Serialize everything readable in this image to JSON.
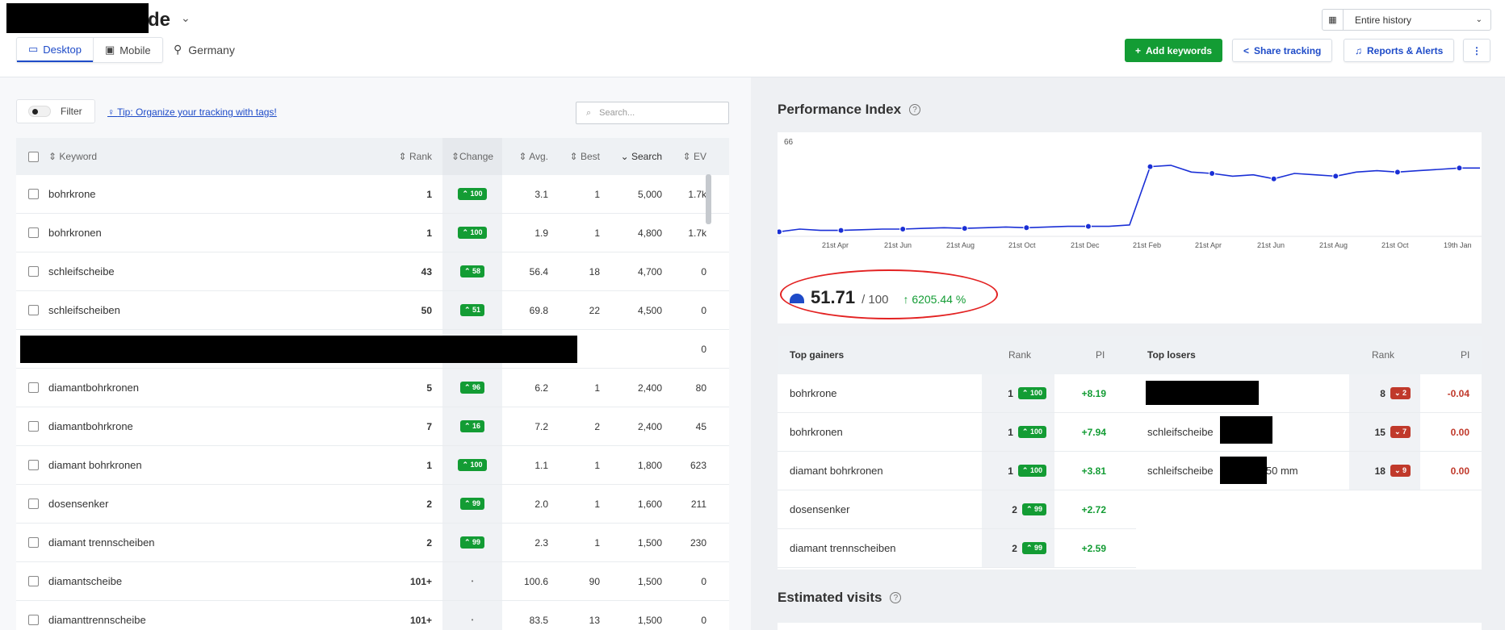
{
  "header": {
    "domain_suffix": "de",
    "devices": [
      "Desktop",
      "Mobile"
    ],
    "location": "Germany",
    "history": "Entire history",
    "buttons": {
      "add_keywords": "Add keywords",
      "share": "Share tracking",
      "reports": "Reports & Alerts"
    }
  },
  "left": {
    "filter_label": "Filter",
    "tip": "Tip: Organize your tracking with tags!",
    "search_placeholder": "Search...",
    "columns": [
      "Keyword",
      "Rank",
      "Change",
      "Avg.",
      "Best",
      "Search",
      "EV"
    ],
    "rows": [
      {
        "kw": "bohrkrone",
        "rank": "1",
        "change": "100",
        "avg": "3.1",
        "best": "1",
        "search": "5,000",
        "ev": "1.7k"
      },
      {
        "kw": "bohrkronen",
        "rank": "1",
        "change": "100",
        "avg": "1.9",
        "best": "1",
        "search": "4,800",
        "ev": "1.7k"
      },
      {
        "kw": "schleifscheibe",
        "rank": "43",
        "change": "58",
        "avg": "56.4",
        "best": "18",
        "search": "4,700",
        "ev": "0"
      },
      {
        "kw": "schleifscheiben",
        "rank": "50",
        "change": "51",
        "avg": "69.8",
        "best": "22",
        "search": "4,500",
        "ev": "0"
      },
      {
        "kw": "",
        "rank": "",
        "change": "",
        "avg": "",
        "best": "",
        "search": "",
        "ev": "0",
        "redacted": true
      },
      {
        "kw": "diamantbohrkronen",
        "rank": "5",
        "change": "96",
        "avg": "6.2",
        "best": "1",
        "search": "2,400",
        "ev": "80"
      },
      {
        "kw": "diamantbohrkrone",
        "rank": "7",
        "change": "16",
        "avg": "7.2",
        "best": "2",
        "search": "2,400",
        "ev": "45"
      },
      {
        "kw": "diamant bohrkronen",
        "rank": "1",
        "change": "100",
        "avg": "1.1",
        "best": "1",
        "search": "1,800",
        "ev": "623"
      },
      {
        "kw": "dosensenker",
        "rank": "2",
        "change": "99",
        "avg": "2.0",
        "best": "1",
        "search": "1,600",
        "ev": "211"
      },
      {
        "kw": "diamant trennscheiben",
        "rank": "2",
        "change": "99",
        "avg": "2.3",
        "best": "1",
        "search": "1,500",
        "ev": "230"
      },
      {
        "kw": "diamantscheibe",
        "rank": "101+",
        "change": "•",
        "avg": "100.6",
        "best": "90",
        "search": "1,500",
        "ev": "0"
      },
      {
        "kw": "diamanttrennscheibe",
        "rank": "101+",
        "change": "•",
        "avg": "83.5",
        "best": "13",
        "search": "1,500",
        "ev": "0"
      }
    ]
  },
  "performance": {
    "title": "Performance Index",
    "value": "51.71",
    "of": "/ 100",
    "delta": "6205.44 %",
    "ymax_label": "66",
    "xticks": [
      "21st Apr",
      "21st Jun",
      "21st Aug",
      "21st Oct",
      "21st Dec",
      "21st Feb",
      "21st Apr",
      "21st Jun",
      "21st Aug",
      "21st Oct",
      "19th Jan"
    ]
  },
  "chart_data": {
    "type": "line",
    "title": "Performance Index",
    "ylim": [
      0,
      66
    ],
    "x_ticks": [
      "21st Apr",
      "21st Jun",
      "21st Aug",
      "21st Oct",
      "21st Dec",
      "21st Feb",
      "21st Apr",
      "21st Jun",
      "21st Aug",
      "21st Oct",
      "19th Jan"
    ],
    "series": [
      {
        "color": "#1a2fd6",
        "values": [
          1,
          3,
          2,
          2,
          2.5,
          3,
          3,
          3.5,
          4,
          3.5,
          4,
          4.5,
          4,
          4.5,
          5,
          5,
          5,
          6,
          49,
          50,
          45,
          44,
          42,
          43,
          40,
          44,
          43,
          42,
          45,
          46,
          45,
          46,
          47,
          48,
          48
        ]
      }
    ]
  },
  "gainers": {
    "title": "Top gainers",
    "rank_label": "Rank",
    "pi_label": "PI",
    "rows": [
      {
        "kw": "bohrkrone",
        "rank": "1",
        "change": "100",
        "pi": "+8.19"
      },
      {
        "kw": "bohrkronen",
        "rank": "1",
        "change": "100",
        "pi": "+7.94"
      },
      {
        "kw": "diamant bohrkronen",
        "rank": "1",
        "change": "100",
        "pi": "+3.81"
      },
      {
        "kw": "dosensenker",
        "rank": "2",
        "change": "99",
        "pi": "+2.72"
      },
      {
        "kw": "diamant trennscheiben",
        "rank": "2",
        "change": "99",
        "pi": "+2.59"
      }
    ]
  },
  "losers": {
    "title": "Top losers",
    "rank_label": "Rank",
    "pi_label": "PI",
    "rows": [
      {
        "kw": "",
        "rank": "8",
        "change": "2",
        "pi": "-0.04"
      },
      {
        "kw": "schleifscheibe",
        "rank": "15",
        "change": "7",
        "pi": "0.00"
      },
      {
        "kw": "schleifscheibe",
        "kw_suffix": "250 mm",
        "rank": "18",
        "change": "9",
        "pi": "0.00"
      }
    ]
  },
  "estimated": {
    "title": "Estimated visits"
  }
}
